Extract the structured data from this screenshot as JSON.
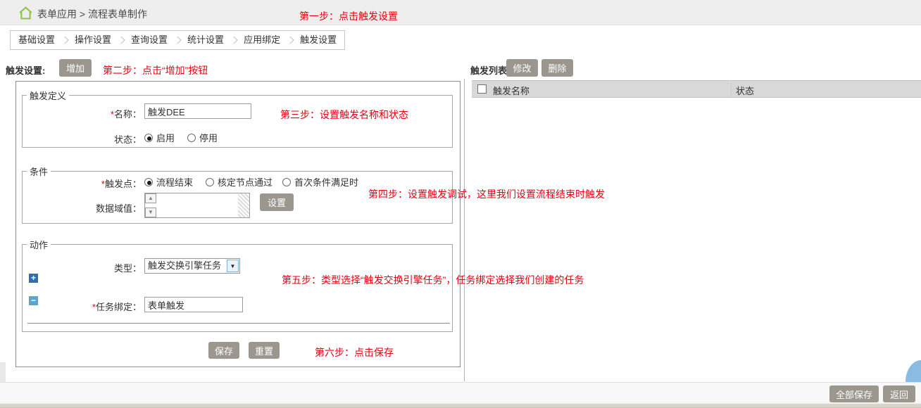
{
  "header": {
    "breadcrumb": "表单应用 > 流程表单制作"
  },
  "steps": {
    "s1": "第一步：点击触发设置",
    "s2": "第二步：点击“增加”按钮",
    "s3": "第三步：设置触发名称和状态",
    "s4": "第四步：设置触发调试，这里我们设置流程结束时触发",
    "s5": "第五步：类型选择“触发交换引擎任务”，任务绑定选择我们创建的任务",
    "s6": "第六步：点击保存"
  },
  "tabs": {
    "items": [
      "基础设置",
      "操作设置",
      "查询设置",
      "统计设置",
      "应用绑定",
      "触发设置"
    ]
  },
  "left_toolbar": {
    "label": "触发设置:",
    "add_button": "增加"
  },
  "form": {
    "required_mark": "*",
    "definition": {
      "legend": "触发定义",
      "name_label": "名称：",
      "name_value": "触发DEE",
      "status_label": "状态：",
      "status_enabled": "启用",
      "status_disabled": "停用"
    },
    "condition": {
      "legend": "条件",
      "point_label": "触发点：",
      "option_flow_end": "流程结束",
      "option_node_pass": "核定节点通过",
      "option_first_condition": "首次条件满足时",
      "data_label": "数据域值：",
      "set_button": "设置"
    },
    "action": {
      "legend": "动作",
      "type_label": "类型：",
      "type_value": "触发交换引擎任务",
      "task_label": "任务绑定：",
      "task_value": "表单触发"
    },
    "save_button": "保存",
    "reset_button": "重置"
  },
  "right_toolbar": {
    "label": "触发列表:",
    "edit_button": "修改",
    "delete_button": "删除"
  },
  "trigger_table": {
    "col_name": "触发名称",
    "col_status": "状态"
  },
  "footer": {
    "save_all_button": "全部保存",
    "back_button": "返回"
  },
  "icons": {
    "plus": "+",
    "minus": "−",
    "dropdown_arrow": "▼",
    "scroll_up": "▲",
    "scroll_down": "▼"
  },
  "colors": {
    "annotation_red": "#e60012",
    "button_gray": "#9b968e",
    "plus_blue": "#2e6db4",
    "minus_blue": "#58a8cd",
    "corner_blue": "#8bbbe0"
  }
}
